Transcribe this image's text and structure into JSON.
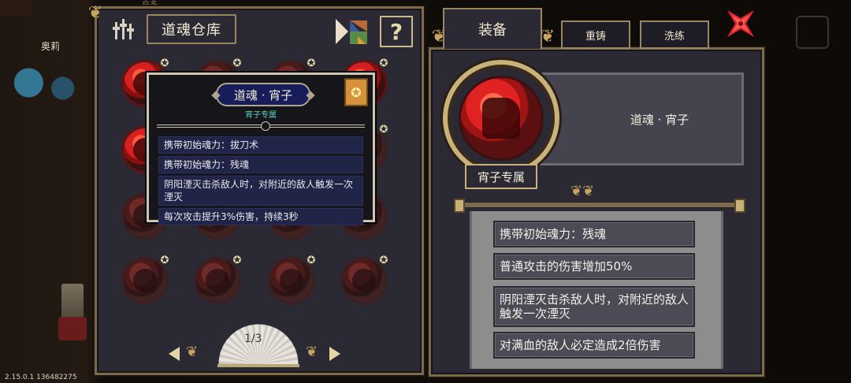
{
  "hud": {
    "version": "2.15.0.1 136482275",
    "player_name": "奥莉",
    "top_hint": "户多"
  },
  "left_panel": {
    "title": "道魂仓库",
    "help_label": "?",
    "pager": {
      "label": "1/3"
    },
    "grid": [
      [
        {
          "active": true,
          "star": true
        },
        {
          "active": false,
          "star": true
        },
        {
          "active": false,
          "star": true
        },
        {
          "active": true,
          "star": true
        }
      ],
      [
        {
          "active": true,
          "star": false
        },
        {
          "active": false,
          "star": false
        },
        {
          "active": false,
          "star": false
        },
        {
          "active": false,
          "star": true
        }
      ],
      [
        {
          "active": false,
          "star": false
        },
        {
          "active": false,
          "star": false
        },
        {
          "active": false,
          "star": false
        },
        {
          "active": false,
          "star": false
        }
      ],
      [
        {
          "active": false,
          "star": true
        },
        {
          "active": false,
          "star": true
        },
        {
          "active": false,
          "star": true
        },
        {
          "active": false,
          "star": true
        }
      ]
    ]
  },
  "tooltip": {
    "title": "道魂 · 宵子",
    "subtitle": "宵子专属",
    "lines": [
      "携带初始魂力：拔刀术",
      "携带初始魂力：残魂",
      "阴阳湮灭击杀敌人时，对附近的敌人触发一次湮灭",
      "每次攻击提升3%伤害，持续3秒"
    ]
  },
  "right_panel": {
    "tabs": {
      "equip": "装备",
      "reforge": "重铸",
      "refine": "洗练"
    },
    "item_name": "道魂 · 宵子",
    "exclusive_label": "宵子专属",
    "effects": [
      "携带初始魂力：残魂",
      "普通攻击的伤害增加50%",
      "阴阳湮灭击杀敌人时，对附近的敌人触发一次湮灭",
      "对满血的敌人必定造成2倍伤害"
    ]
  },
  "colors": {
    "panel_bg": "#2b2933",
    "frame_gold": "#c9b17a",
    "tooltip_line_bg": "#202548",
    "orb_red": "#d42020",
    "close_red": "#e0242c"
  }
}
